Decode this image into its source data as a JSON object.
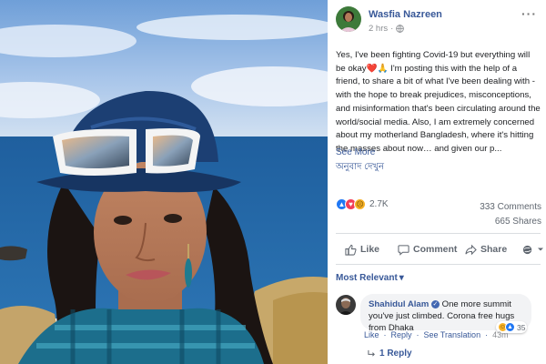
{
  "post": {
    "author": "Wasfia Nazreen",
    "time": "2 hrs",
    "text": {
      "line1": "Yes, I've been fighting Covid-19 but everything will be okay",
      "emoji_heart": "❤️",
      "emoji_pray": "🙏",
      "line2": " I'm posting this with the help of a friend, to share a bit of what I've been dealing with - with the hope to break prejudices, misconceptions, and misinformation that's been circulating around the world/social media. Also, I am extremely concerned about my motherland Bangladesh, where it's hitting the masses about now… and given our p..."
    },
    "see_more": "See More",
    "translate": "অনুবাদ দেখুন"
  },
  "stats": {
    "reactions_count": "2.7K",
    "comments_count": "333 Comments",
    "views_count": "665 Shares"
  },
  "actions": {
    "like": "Like",
    "comment": "Comment",
    "share": "Share"
  },
  "sort": {
    "label": "Most Relevant",
    "caret": "▾"
  },
  "comment": {
    "author": "Shahidul Alam",
    "text": "One more summit you've just climbed. Corona free hugs from Dhaka",
    "reaction_count": "35",
    "like": "Like",
    "reply": "Reply",
    "see_translation": "See Translation",
    "time": "43m",
    "separator": "·"
  },
  "replies": {
    "label": "1 Reply"
  },
  "icons": {
    "globe": "globe-icon",
    "more": "more-icon",
    "like": "thumbs-up-icon",
    "comment": "speech-bubble-icon",
    "share": "share-arrow-icon",
    "reply": "reply-arrow-icon"
  },
  "colors": {
    "link": "#385898",
    "like_blue": "#2078f4",
    "love_red": "#f33e58",
    "muted": "#606770"
  }
}
